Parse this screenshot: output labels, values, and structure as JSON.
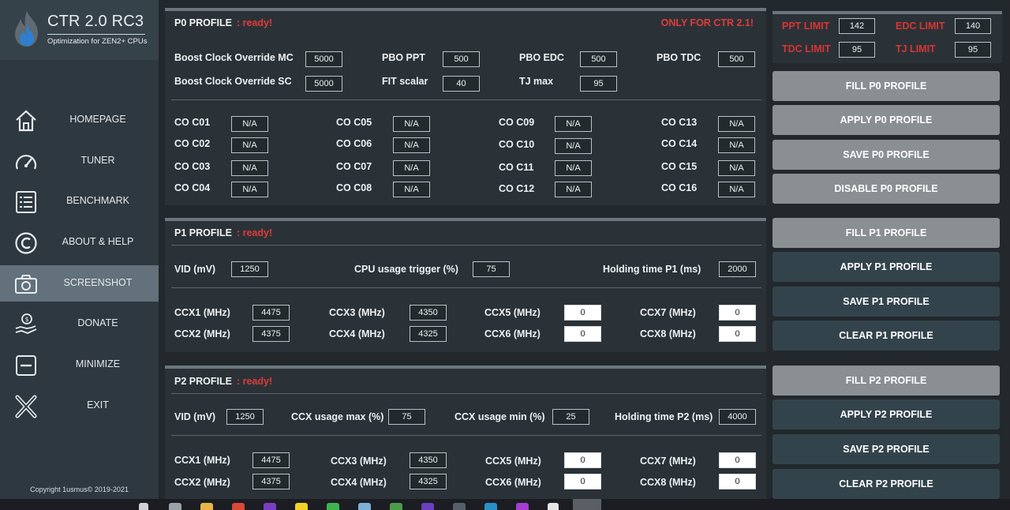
{
  "app": {
    "title": "CTR 2.0 RC3",
    "subtitle": "Optimization for ZEN2+ CPUs",
    "copyright": "Copyright 1usmus© 2019-2021"
  },
  "nav": [
    {
      "label": "HOMEPAGE",
      "icon": "home-icon"
    },
    {
      "label": "TUNER",
      "icon": "speedometer-icon"
    },
    {
      "label": "BENCHMARK",
      "icon": "list-icon"
    },
    {
      "label": "ABOUT & HELP",
      "icon": "copyright-icon"
    },
    {
      "label": "SCREENSHOT",
      "icon": "camera-icon",
      "active": true
    },
    {
      "label": "DONATE",
      "icon": "donate-icon"
    },
    {
      "label": "MINIMIZE",
      "icon": "minimize-icon"
    },
    {
      "label": "EXIT",
      "icon": "close-icon"
    }
  ],
  "p0": {
    "title": "P0 PROFILE",
    "status": ": ready!",
    "warning": "ONLY FOR CTR 2.1!",
    "fields": {
      "boost_mc": {
        "label": "Boost Clock Override MC",
        "value": "5000"
      },
      "boost_sc": {
        "label": "Boost Clock Override SC",
        "value": "5000"
      },
      "pbo_ppt": {
        "label": "PBO PPT",
        "value": "500"
      },
      "fit_scalar": {
        "label": "FIT scalar",
        "value": "40"
      },
      "pbo_edc": {
        "label": "PBO EDC",
        "value": "500"
      },
      "tj_max": {
        "label": "TJ max",
        "value": "95"
      },
      "pbo_tdc": {
        "label": "PBO TDC",
        "value": "500"
      }
    },
    "co": [
      {
        "label": "CO C01",
        "value": "N/A"
      },
      {
        "label": "CO C02",
        "value": "N/A"
      },
      {
        "label": "CO C03",
        "value": "N/A"
      },
      {
        "label": "CO C04",
        "value": "N/A"
      },
      {
        "label": "CO C05",
        "value": "N/A"
      },
      {
        "label": "CO C06",
        "value": "N/A"
      },
      {
        "label": "CO C07",
        "value": "N/A"
      },
      {
        "label": "CO C08",
        "value": "N/A"
      },
      {
        "label": "CO C09",
        "value": "N/A"
      },
      {
        "label": "CO C10",
        "value": "N/A"
      },
      {
        "label": "CO C11",
        "value": "N/A"
      },
      {
        "label": "CO C12",
        "value": "N/A"
      },
      {
        "label": "CO C13",
        "value": "N/A"
      },
      {
        "label": "CO C14",
        "value": "N/A"
      },
      {
        "label": "CO C15",
        "value": "N/A"
      },
      {
        "label": "CO C16",
        "value": "N/A"
      }
    ]
  },
  "p1": {
    "title": "P1 PROFILE",
    "status": ": ready!",
    "vid": {
      "label": "VID (mV)",
      "value": "1250"
    },
    "cpu_trigger": {
      "label": "CPU usage trigger (%)",
      "value": "75"
    },
    "holding": {
      "label": "Holding time P1 (ms)",
      "value": "2000"
    },
    "ccx": [
      {
        "label": "CCX1 (MHz)",
        "value": "4475"
      },
      {
        "label": "CCX2 (MHz)",
        "value": "4375"
      },
      {
        "label": "CCX3 (MHz)",
        "value": "4350"
      },
      {
        "label": "CCX4 (MHz)",
        "value": "4325"
      },
      {
        "label": "CCX5 (MHz)",
        "value": "0"
      },
      {
        "label": "CCX6 (MHz)",
        "value": "0"
      },
      {
        "label": "CCX7 (MHz)",
        "value": "0"
      },
      {
        "label": "CCX8 (MHz)",
        "value": "0"
      }
    ]
  },
  "p2": {
    "title": "P2 PROFILE",
    "status": ": ready!",
    "vid": {
      "label": "VID (mV)",
      "value": "1250"
    },
    "ccx_max": {
      "label": "CCX usage max (%)",
      "value": "75"
    },
    "ccx_min": {
      "label": "CCX usage min (%)",
      "value": "25"
    },
    "holding": {
      "label": "Holding time P2 (ms)",
      "value": "4000"
    },
    "ccx": [
      {
        "label": "CCX1 (MHz)",
        "value": "4475"
      },
      {
        "label": "CCX2 (MHz)",
        "value": "4375"
      },
      {
        "label": "CCX3 (MHz)",
        "value": "4350"
      },
      {
        "label": "CCX4 (MHz)",
        "value": "4325"
      },
      {
        "label": "CCX5 (MHz)",
        "value": "0"
      },
      {
        "label": "CCX6 (MHz)",
        "value": "0"
      },
      {
        "label": "CCX7 (MHz)",
        "value": "0"
      },
      {
        "label": "CCX8 (MHz)",
        "value": "0"
      }
    ]
  },
  "limits": {
    "ppt": {
      "label": "PPT LIMIT",
      "value": "142"
    },
    "edc": {
      "label": "EDC LIMIT",
      "value": "140"
    },
    "tdc": {
      "label": "TDC LIMIT",
      "value": "95"
    },
    "tj": {
      "label": "TJ LIMIT",
      "value": "95"
    }
  },
  "buttons": {
    "fill_p0": "FILL P0 PROFILE",
    "apply_p0": "APPLY P0 PROFILE",
    "save_p0": "SAVE P0 PROFILE",
    "disable_p0": "DISABLE P0 PROFILE",
    "fill_p1": "FILL P1 PROFILE",
    "apply_p1": "APPLY P1 PROFILE",
    "save_p1": "SAVE P1 PROFILE",
    "clear_p1": "CLEAR P1 PROFILE",
    "fill_p2": "FILL P2 PROFILE",
    "apply_p2": "APPLY P2 PROFILE",
    "save_p2": "SAVE P2 PROFILE",
    "clear_p2": "CLEAR P2 PROFILE"
  },
  "colors": {
    "accent_red": "#e03b3b",
    "sidebar": "#2e3840",
    "active_nav": "#62717b",
    "button_gray": "#8a8f92",
    "button_dark": "#33434c"
  }
}
